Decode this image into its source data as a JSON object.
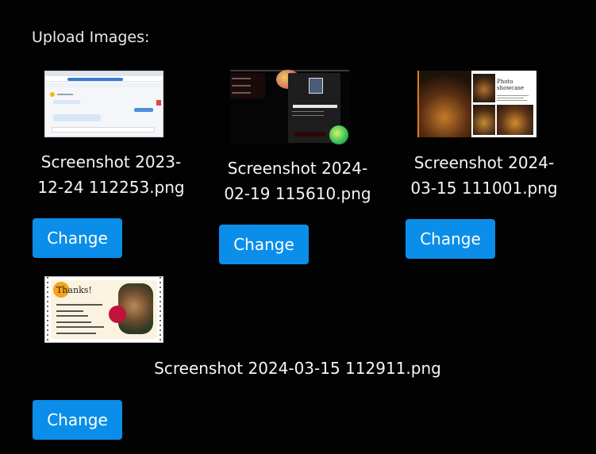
{
  "page": {
    "heading": "Upload Images:"
  },
  "images": [
    {
      "filename": "Screenshot 2023-\n12-24 112253.png",
      "button_label": "Change"
    },
    {
      "filename": "Screenshot 2024-\n02-19 115610.png",
      "button_label": "Change"
    },
    {
      "filename": "Screenshot 2024-\n03-15 111001.png",
      "button_label": "Change"
    },
    {
      "filename": "Screenshot 2024-03-15 112911.png",
      "button_label": "Change"
    }
  ],
  "thumbnails": {
    "profile_name": "Mohamed Sajeer M",
    "showcase_title": "Photo showcase",
    "thanks_text": "Thanks!"
  },
  "colors": {
    "background": "#020202",
    "button": "#0b8ee9",
    "text": "#f5f5f5"
  }
}
